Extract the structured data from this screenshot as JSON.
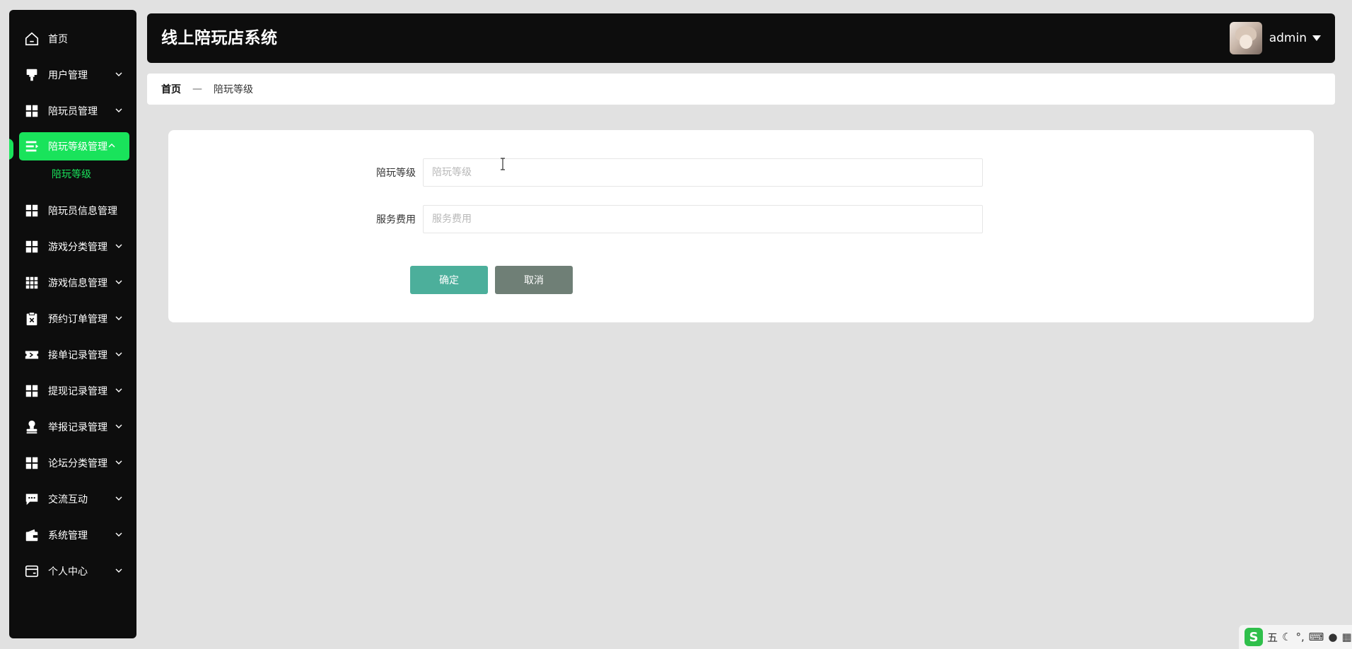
{
  "app": {
    "title": "线上陪玩店系统"
  },
  "user": {
    "name": "admin"
  },
  "sidebar": {
    "items": [
      {
        "label": "首页",
        "icon": "home-icon",
        "chevron": false
      },
      {
        "label": "用户管理",
        "icon": "user-manage-icon",
        "chevron": true
      },
      {
        "label": "陪玩员管理",
        "icon": "grid-icon",
        "chevron": true
      },
      {
        "label": "陪玩等级管理",
        "icon": "list-icon",
        "chevron": true,
        "active": true,
        "sub": [
          "陪玩等级"
        ]
      },
      {
        "label": "陪玩员信息管理",
        "icon": "grid-icon",
        "chevron": true
      },
      {
        "label": "游戏分类管理",
        "icon": "grid-icon",
        "chevron": true
      },
      {
        "label": "游戏信息管理",
        "icon": "apps-icon",
        "chevron": true
      },
      {
        "label": "预约订单管理",
        "icon": "clipboard-x-icon",
        "chevron": true
      },
      {
        "label": "接单记录管理",
        "icon": "ticket-icon",
        "chevron": true
      },
      {
        "label": "提现记录管理",
        "icon": "grid-icon",
        "chevron": true
      },
      {
        "label": "举报记录管理",
        "icon": "stamp-icon",
        "chevron": true
      },
      {
        "label": "论坛分类管理",
        "icon": "grid-icon",
        "chevron": true
      },
      {
        "label": "交流互动",
        "icon": "chat-icon",
        "chevron": true
      },
      {
        "label": "系统管理",
        "icon": "wallet-icon",
        "chevron": true
      },
      {
        "label": "个人中心",
        "icon": "card-icon",
        "chevron": true
      }
    ]
  },
  "breadcrumb": {
    "home": "首页",
    "separator": "—",
    "current": "陪玩等级"
  },
  "form": {
    "level": {
      "label": "陪玩等级",
      "placeholder": "陪玩等级",
      "value": ""
    },
    "fee": {
      "label": "服务费用",
      "placeholder": "服务费用",
      "value": ""
    },
    "confirm_label": "确定",
    "cancel_label": "取消"
  },
  "ime": {
    "logo": "S",
    "mode": "五"
  },
  "colors": {
    "accent": "#19e35b",
    "confirm": "#4caf9b",
    "cancel": "#6f7f76",
    "sidebar": "#0d0d0d"
  }
}
